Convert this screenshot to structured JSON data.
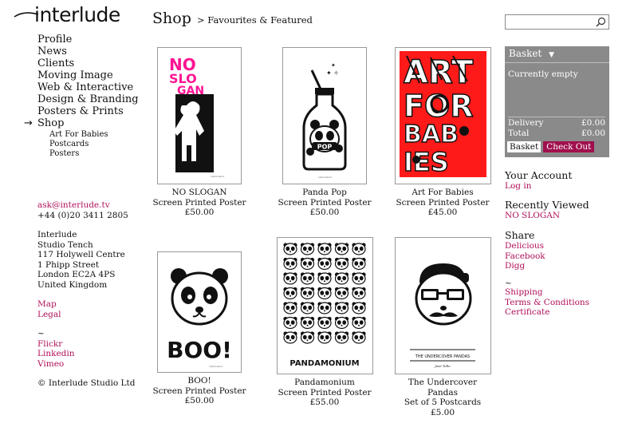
{
  "brand": {
    "name": "interlude"
  },
  "nav": {
    "items": [
      {
        "label": "Profile"
      },
      {
        "label": "News"
      },
      {
        "label": "Clients"
      },
      {
        "label": "Moving Image"
      },
      {
        "label": "Web & Interactive"
      },
      {
        "label": "Design & Branding"
      },
      {
        "label": "Posters & Prints"
      },
      {
        "label": "Shop",
        "active": true
      }
    ],
    "active_marker": "→",
    "sub_items": [
      {
        "label": "Art For Babies"
      },
      {
        "label": "Postcards"
      },
      {
        "label": "Posters"
      }
    ]
  },
  "contact": {
    "email": "ask@interlude.tv",
    "phone": "+44 (0)20 3411 2805",
    "address": [
      "Interlude",
      "Studio Tench",
      "117 Holywell Centre",
      "1 Phipp Street",
      "London EC2A 4PS",
      "United Kingdom"
    ],
    "map": "Map",
    "legal": "Legal",
    "tilde": "~",
    "flickr": "Flickr",
    "linkedin": "Linkedin",
    "vimeo": "Vimeo",
    "copyright": "© Interlude Studio Ltd"
  },
  "page": {
    "title": "Shop",
    "breadcrumb": "> Favourites & Featured"
  },
  "products": [
    {
      "name": "NO SLOGAN",
      "desc": "Screen Printed Poster",
      "price": "£50.00",
      "poster_text": "NO SLO GAN"
    },
    {
      "name": "Panda Pop",
      "desc": "Screen Printed Poster",
      "price": "£50.00",
      "poster_text": "POP"
    },
    {
      "name": "Art For Babies",
      "desc": "Screen Printed Poster",
      "price": "£45.00",
      "poster_text": "ART FOR BABIES"
    },
    {
      "name": "BOO!",
      "desc": "Screen Printed Poster",
      "price": "£50.00",
      "poster_text": "BOO!"
    },
    {
      "name": "Pandamonium",
      "desc": "Screen Printed Poster",
      "price": "£55.00",
      "poster_text": "PANDAMONIUM"
    },
    {
      "name": "The Undercover Pandas",
      "desc": "Set of 5 Postcards",
      "price": "£5.00",
      "poster_text": "THE UNDERCOVER PANDAS"
    }
  ],
  "search": {
    "placeholder": "",
    "icon": "magnifier-icon"
  },
  "basket": {
    "title": "Basket",
    "toggle": "▼",
    "status": "Currently empty",
    "delivery_label": "Delivery",
    "delivery_value": "£0.00",
    "total_label": "Total",
    "total_value": "£0.00",
    "basket_button": "Basket",
    "checkout_button": "Check Out"
  },
  "account": {
    "title": "Your Account",
    "login": "Log in"
  },
  "recent": {
    "title": "Recently Viewed",
    "item": "NO SLOGAN"
  },
  "share": {
    "title": "Share",
    "links": [
      "Delicious",
      "Facebook",
      "Digg"
    ]
  },
  "footer_links": {
    "tilde": "~",
    "links": [
      "Shipping",
      "Terms & Conditions",
      "Certificate"
    ]
  },
  "colors": {
    "link": "#b0105a",
    "basket_bg": "#8a8a8a",
    "checkout": "#a0104d",
    "poster_red": "#ff1a1a",
    "poster_pink": "#ff1493"
  }
}
